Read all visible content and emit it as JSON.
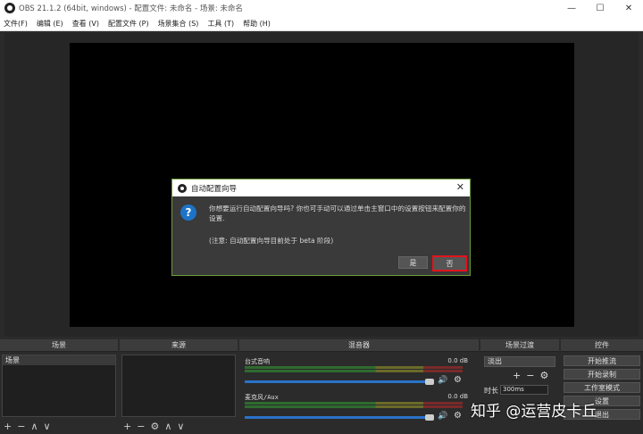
{
  "window": {
    "title": "OBS 21.1.2 (64bit, windows) - 配置文件: 未命名 - 场景: 未命名",
    "minimize": "—",
    "maximize": "☐",
    "close": "✕"
  },
  "menu": [
    "文件(F)",
    "编辑 (E)",
    "查看 (V)",
    "配置文件 (P)",
    "场景集合 (S)",
    "工具 (T)",
    "帮助 (H)"
  ],
  "dialog": {
    "title": "自动配置向导",
    "close": "✕",
    "icon": "question-icon",
    "icon_glyph": "?",
    "message": "你想要运行自动配置向导吗? 你也可手动可以通过单击主窗口中的设置按钮来配置你的设置.",
    "note": "(注意: 自动配置向导目前处于 beta 阶段)",
    "yes_label": "是",
    "no_label": "否",
    "highlight_color": "#e2141b"
  },
  "docks": {
    "scenes": {
      "title": "场景",
      "items": [
        "场景"
      ]
    },
    "sources": {
      "title": "来源"
    },
    "mixer": {
      "title": "混音器",
      "channels": [
        {
          "name": "台式音响",
          "db": "0.0 dB"
        },
        {
          "name": "麦克风/Aux",
          "db": "0.0 dB"
        }
      ]
    },
    "transitions": {
      "title": "场景过渡",
      "selected": "淡出",
      "duration_label": "时长",
      "duration_value": "300ms"
    },
    "controls": {
      "title": "控件",
      "buttons": [
        "开始推流",
        "开始录制",
        "工作室模式",
        "设置",
        "退出"
      ]
    }
  },
  "watermark": "知乎 @运营皮卡丘"
}
